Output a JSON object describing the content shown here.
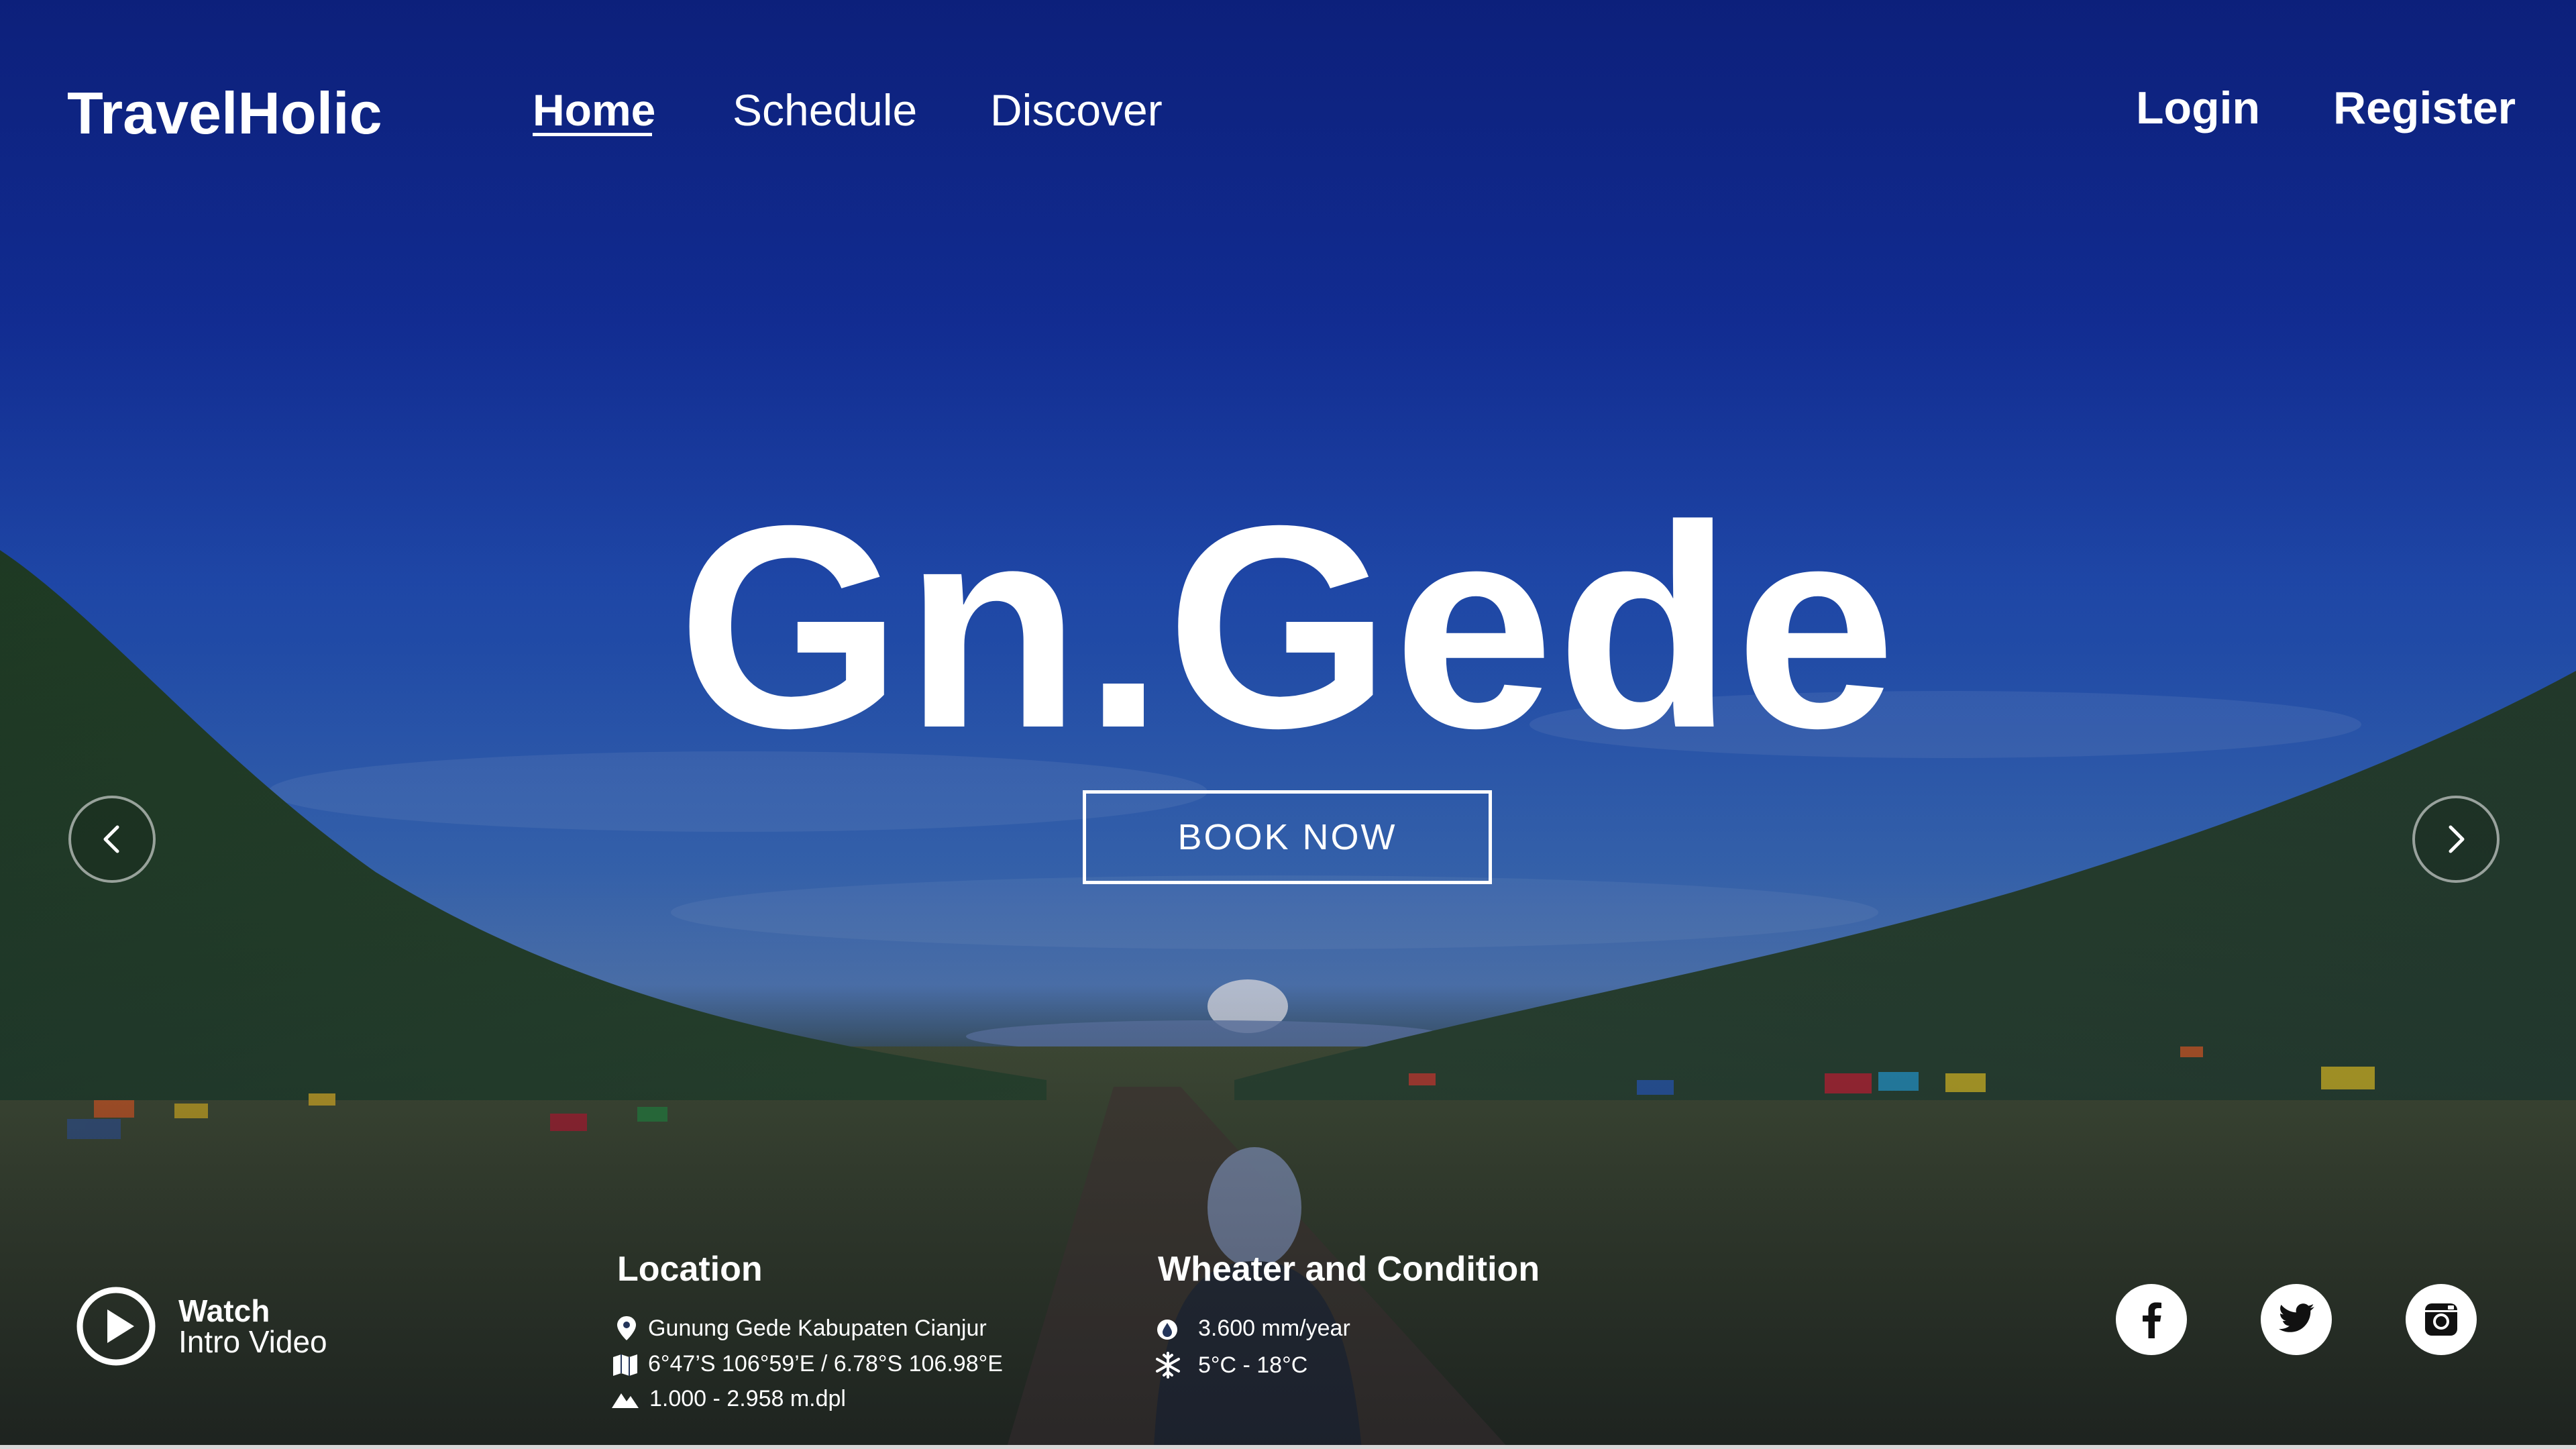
{
  "brand": {
    "name": "TravelHolic"
  },
  "nav": {
    "links": [
      {
        "label": "Home",
        "active": true
      },
      {
        "label": "Schedule",
        "active": false
      },
      {
        "label": "Discover",
        "active": false
      }
    ],
    "login": "Login",
    "register": "Register"
  },
  "hero": {
    "title": "Gn.Gede",
    "book_label": "BOOK NOW"
  },
  "watch": {
    "line1": "Watch",
    "line2": "Intro Video",
    "icon": "play-circle-icon"
  },
  "location": {
    "title": "Location",
    "items": [
      {
        "icon": "map-pin-icon",
        "text": "Gunung Gede Kabupaten Cianjur"
      },
      {
        "icon": "map-icon",
        "text": "6°47’S 106°59’E / 6.78°S 106.98°E"
      },
      {
        "icon": "mountain-icon",
        "text": "1.000 - 2.958 m.dpl"
      }
    ]
  },
  "condition": {
    "title": "Wheater and Condition",
    "items": [
      {
        "icon": "raindrop-icon",
        "text": "3.600 mm/year"
      },
      {
        "icon": "snowflake-icon",
        "text": "5°C - 18°C"
      }
    ]
  },
  "social": [
    "facebook-icon",
    "twitter-icon",
    "instagram-icon"
  ],
  "colors": {
    "sky": "#13309a",
    "text": "#ffffff",
    "ground": "#3f4a28"
  }
}
